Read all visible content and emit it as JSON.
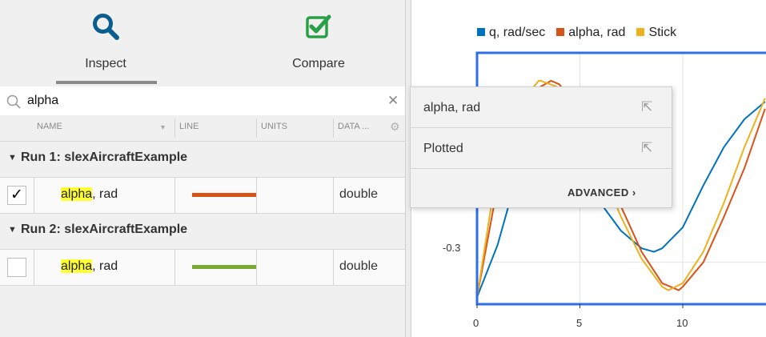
{
  "tabs": {
    "inspect_label": "Inspect",
    "compare_label": "Compare"
  },
  "search": {
    "value": "alpha",
    "placeholder": ""
  },
  "columns": {
    "name": "NAME",
    "line": "LINE",
    "units": "UNITS",
    "data_type": "DATA ..."
  },
  "runs": [
    {
      "title": "Run 1: slexAircraftExample",
      "signal": {
        "highlight": "alpha",
        "rest": ", rad",
        "checked": true,
        "line_color": "#d95319",
        "data_type": "double"
      }
    },
    {
      "title": "Run 2: slexAircraftExample",
      "signal": {
        "highlight": "alpha",
        "rest": ", rad",
        "checked": false,
        "line_color": "#77ac30",
        "data_type": "double"
      }
    }
  ],
  "popup": {
    "item1": "alpha, rad",
    "item2": "Plotted",
    "advanced": "ADVANCED"
  },
  "chart_data": {
    "type": "line",
    "title": "",
    "xlabel": "",
    "ylabel": "",
    "xlim": [
      0,
      14
    ],
    "ylim": [
      -0.42,
      0.3
    ],
    "x_ticks": [
      "0",
      "5",
      "10"
    ],
    "y_ticks": [
      "-0.3"
    ],
    "grid": true,
    "legend_position": "top",
    "series": [
      {
        "name": "q, rad/sec",
        "color": "#0072bd",
        "x": [
          0,
          1,
          2,
          3,
          4,
          5,
          6,
          7,
          8,
          8.6,
          9,
          10,
          11,
          12,
          13,
          14
        ],
        "y": [
          -0.4,
          -0.25,
          -0.04,
          0.08,
          0.05,
          -0.04,
          -0.13,
          -0.21,
          -0.26,
          -0.27,
          -0.26,
          -0.2,
          -0.08,
          0.03,
          0.11,
          0.16
        ]
      },
      {
        "name": "alpha, rad",
        "color": "#d95319",
        "x": [
          0,
          1,
          2,
          3,
          3.6,
          4,
          5,
          6,
          7,
          8,
          9,
          9.8,
          10,
          11,
          12,
          13,
          14
        ],
        "y": [
          -0.4,
          -0.08,
          0.1,
          0.2,
          0.22,
          0.21,
          0.13,
          0.0,
          -0.14,
          -0.27,
          -0.36,
          -0.38,
          -0.37,
          -0.3,
          -0.17,
          -0.03,
          0.14
        ]
      },
      {
        "name": "Stick",
        "color": "#edb120",
        "x": [
          0,
          1,
          2,
          3,
          3.1,
          4,
          5,
          6,
          7,
          8,
          9,
          9.3,
          10,
          11,
          12,
          13,
          14
        ],
        "y": [
          -0.4,
          -0.02,
          0.15,
          0.22,
          0.22,
          0.2,
          0.1,
          -0.03,
          -0.17,
          -0.29,
          -0.37,
          -0.38,
          -0.36,
          -0.27,
          -0.13,
          0.03,
          0.17
        ]
      }
    ]
  }
}
